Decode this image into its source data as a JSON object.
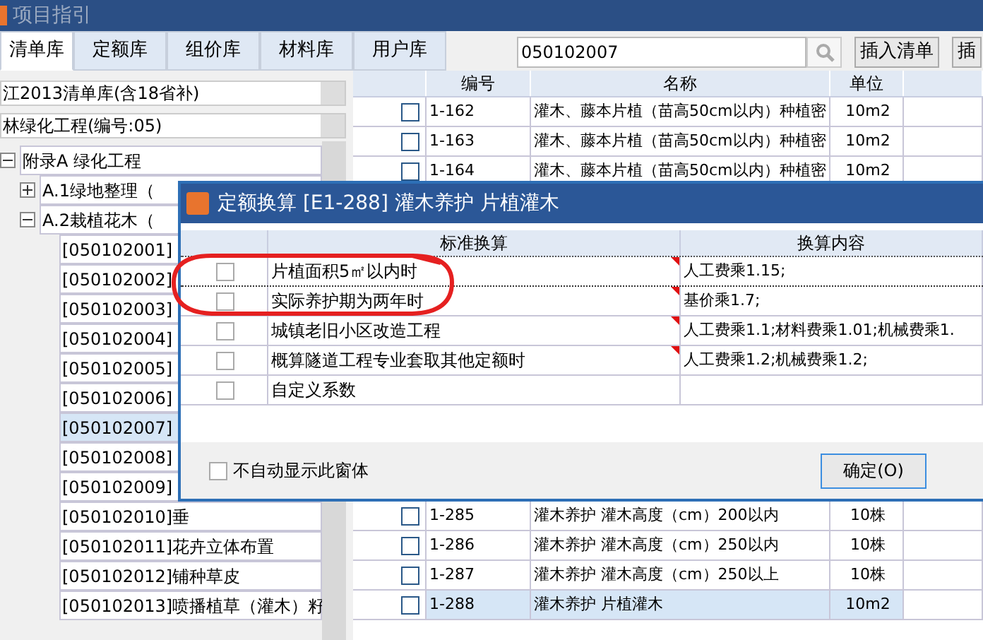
{
  "window": {
    "title": "项目指引"
  },
  "tabs": [
    {
      "label": "清单库",
      "selected": true
    },
    {
      "label": "定额库",
      "selected": false
    },
    {
      "label": "组价库",
      "selected": false
    },
    {
      "label": "材料库",
      "selected": false
    },
    {
      "label": "用户库",
      "selected": false
    }
  ],
  "search": {
    "value": "050102007"
  },
  "buttons": [
    "插入清单",
    "插"
  ],
  "library_select": {
    "value": "江2013清单库(含18省补)"
  },
  "section_select": {
    "value": "林绿化工程(编号:05)"
  },
  "tree": [
    {
      "label": "附录A 绿化工程",
      "expanded": true,
      "children": [
        {
          "label": "A.1绿地整理（",
          "expanded": false
        },
        {
          "label": "A.2栽植花木（",
          "expanded": true,
          "children": [
            {
              "label": "[050102001]",
              "selected": false
            },
            {
              "label": "[050102002]",
              "selected": false
            },
            {
              "label": "[050102003]",
              "selected": false
            },
            {
              "label": "[050102004]",
              "selected": false
            },
            {
              "label": "[050102005]",
              "selected": false
            },
            {
              "label": "[050102006]",
              "selected": false
            },
            {
              "label": "[050102007]",
              "selected": true
            },
            {
              "label": "[050102008]",
              "selected": false
            },
            {
              "label": "[050102009]",
              "selected": false
            },
            {
              "label": "[050102010]垂",
              "selected": false
            },
            {
              "label": "[050102011]花卉立体布置",
              "selected": false
            },
            {
              "label": "[050102012]铺种草皮",
              "selected": false
            },
            {
              "label": "[050102013]喷播植草（灌木）籽",
              "selected": false
            }
          ]
        }
      ]
    }
  ],
  "table": {
    "columns": [
      "编号",
      "名称",
      "单位"
    ],
    "rows": [
      {
        "code": "1-162",
        "name": "灌木、藤本片植（苗高50cm以内）种植密",
        "unit": "10m2",
        "checked": false,
        "selected": false
      },
      {
        "code": "1-163",
        "name": "灌木、藤本片植（苗高50cm以内）种植密",
        "unit": "10m2",
        "checked": false,
        "selected": false
      },
      {
        "code": "1-164",
        "name": "灌木、藤本片植（苗高50cm以内）种植密",
        "unit": "10m2",
        "checked": false,
        "selected": false
      }
    ],
    "rows_below_dialog": [
      {
        "code": "1-285",
        "name": "灌木养护 灌木高度（cm）200以内",
        "unit": "10株",
        "checked": false,
        "selected": false
      },
      {
        "code": "1-286",
        "name": "灌木养护 灌木高度（cm）250以内",
        "unit": "10株",
        "checked": false,
        "selected": false
      },
      {
        "code": "1-287",
        "name": "灌木养护 灌木高度（cm）250以上",
        "unit": "10株",
        "checked": false,
        "selected": false
      },
      {
        "code": "1-288",
        "name": "灌木养护 片植灌木",
        "unit": "10m2",
        "checked": false,
        "selected": true
      }
    ]
  },
  "dialog": {
    "title": "定额换算 [E1-288] 灌木养护 片植灌木",
    "columns": [
      "标准换算",
      "换算内容"
    ],
    "rows": [
      {
        "checked": false,
        "focused": true,
        "flag": true,
        "label": "片植面积5㎡以内时",
        "content": "人工费乘1.15;"
      },
      {
        "checked": false,
        "focused": false,
        "flag": true,
        "label": "实际养护期为两年时",
        "content": "基价乘1.7;"
      },
      {
        "checked": false,
        "focused": false,
        "flag": true,
        "label": "城镇老旧小区改造工程",
        "content": "人工费乘1.1;材料费乘1.01;机械费乘1."
      },
      {
        "checked": false,
        "focused": false,
        "flag": true,
        "label": "概算隧道工程专业套取其他定额时",
        "content": "人工费乘1.2;机械费乘1.2;"
      },
      {
        "checked": false,
        "focused": false,
        "flag": false,
        "label": "自定义系数",
        "content": ""
      }
    ],
    "auto_show": {
      "label": "不自动显示此窗体",
      "checked": false
    },
    "buttons": [
      "确定(O)"
    ]
  }
}
